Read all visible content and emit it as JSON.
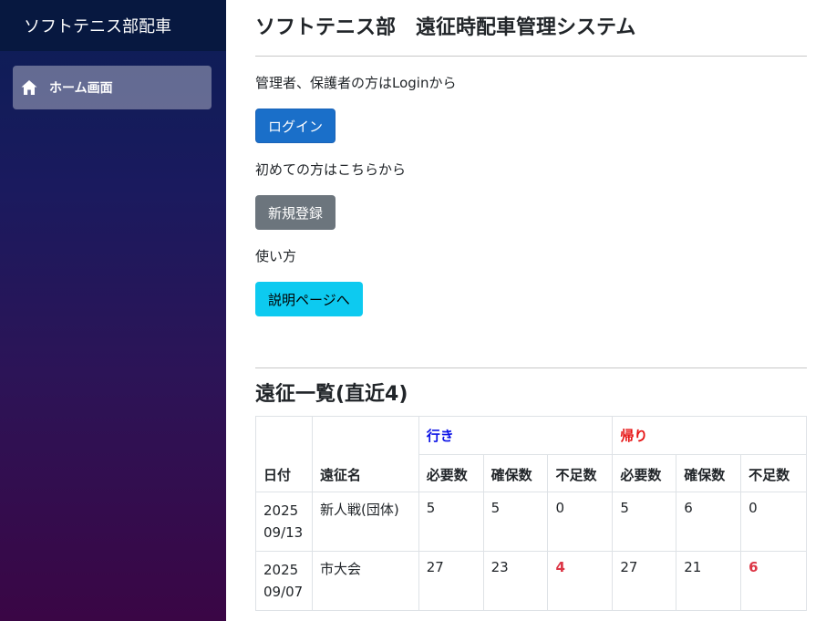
{
  "sidebar": {
    "brand": "ソフトテニス部配車",
    "items": [
      {
        "label": "ホーム画面",
        "icon": "home-icon"
      }
    ]
  },
  "main": {
    "title": "ソフトテニス部　遠征時配車管理システム",
    "login_note": "管理者、保護者の方はLoginから",
    "login_button": "ログイン",
    "register_note": "初めての方はこちらから",
    "register_button": "新規登録",
    "usage_note": "使い方",
    "usage_button": "説明ページへ",
    "list_title": "遠征一覧(直近4)"
  },
  "table": {
    "headers": {
      "date": "日付",
      "name": "遠征名",
      "go": "行き",
      "back": "帰り",
      "required": "必要数",
      "secured": "確保数",
      "shortage": "不足数"
    },
    "rows": [
      {
        "year": "2025",
        "date": "09/13",
        "name": "新人戦(団体)",
        "go_required": "5",
        "go_secured": "5",
        "go_shortage": "0",
        "back_required": "5",
        "back_secured": "6",
        "back_shortage": "0"
      },
      {
        "year": "2025",
        "date": "09/07",
        "name": "市大会",
        "go_required": "27",
        "go_secured": "23",
        "go_shortage": "4",
        "back_required": "27",
        "back_secured": "21",
        "back_shortage": "6"
      }
    ]
  },
  "colors": {
    "go": "#0d14e6",
    "back": "#e61414",
    "shortage": "#dc3545",
    "primary": "#1a6fc9"
  }
}
